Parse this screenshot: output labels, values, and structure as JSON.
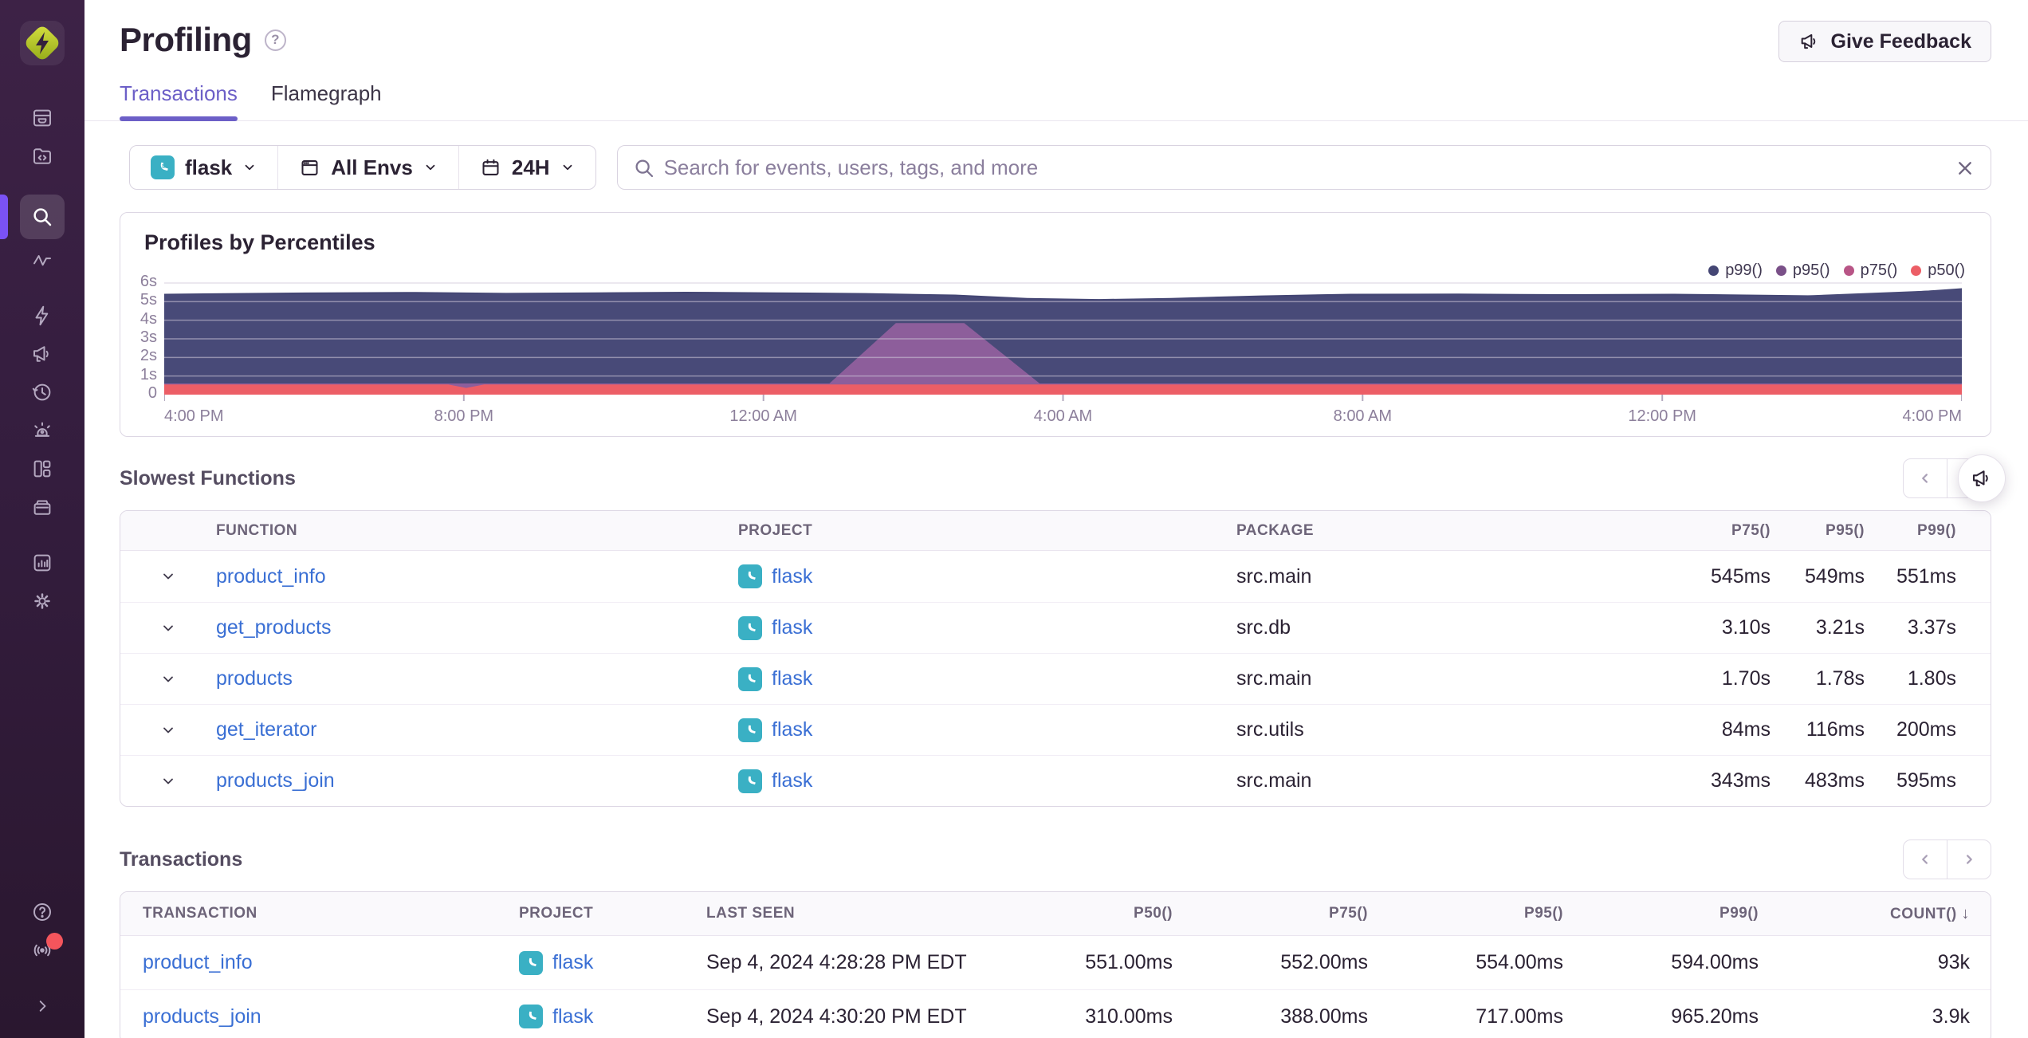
{
  "header": {
    "title": "Profiling",
    "help": "?",
    "feedback_label": "Give Feedback"
  },
  "tabs": {
    "items": [
      {
        "label": "Transactions",
        "active": true
      },
      {
        "label": "Flamegraph",
        "active": false
      }
    ]
  },
  "filters": {
    "project": "flask",
    "environment": "All Envs",
    "period": "24H"
  },
  "search": {
    "placeholder": "Search for events, users, tags, and more"
  },
  "sidebar": {
    "active_item": "search",
    "icons_top": [
      "org-logo",
      "issues-icon",
      "projects-icon",
      "search-icon",
      "metrics-icon",
      "quickstart-icon",
      "feedback-icon",
      "replays-icon",
      "alerts-icon",
      "dashboards-icon",
      "archive-icon",
      "stats-icon",
      "settings-icon"
    ],
    "icons_bottom": [
      "help-icon",
      "whats-new-icon",
      "collapse-icon"
    ],
    "notification_dot_color": "#f4555c",
    "accent_color": "#7a52f5"
  },
  "chart_panel": {
    "title": "Profiles by Percentiles"
  },
  "chart_data": {
    "type": "area",
    "title": "Profiles by Percentiles",
    "unit": "seconds",
    "ylim": [
      0,
      6
    ],
    "y_axis": [
      "0",
      "1s",
      "2s",
      "3s",
      "4s",
      "5s",
      "6s"
    ],
    "x_axis": [
      "4:00 PM",
      "8:00 PM",
      "12:00 AM",
      "4:00 AM",
      "8:00 AM",
      "12:00 PM",
      "4:00 PM"
    ],
    "legend_position": "top-right",
    "grid": true,
    "series": [
      {
        "name": "p99()",
        "legend_color": "#444674",
        "fill": "#444674",
        "points": [
          [
            0,
            5.42
          ],
          [
            0.04,
            5.46
          ],
          [
            0.09,
            5.5
          ],
          [
            0.14,
            5.52
          ],
          [
            0.19,
            5.47
          ],
          [
            0.24,
            5.5
          ],
          [
            0.29,
            5.53
          ],
          [
            0.34,
            5.5
          ],
          [
            0.39,
            5.46
          ],
          [
            0.44,
            5.38
          ],
          [
            0.48,
            5.2
          ],
          [
            0.52,
            5.14
          ],
          [
            0.56,
            5.2
          ],
          [
            0.61,
            5.33
          ],
          [
            0.66,
            5.42
          ],
          [
            0.72,
            5.43
          ],
          [
            0.78,
            5.4
          ],
          [
            0.84,
            5.42
          ],
          [
            0.89,
            5.37
          ],
          [
            0.93,
            5.32
          ],
          [
            0.96,
            5.45
          ],
          [
            1,
            5.72
          ]
        ]
      },
      {
        "name": "p95()",
        "legend_color": "#7a5088",
        "fill": "#484a78",
        "points": [
          [
            0,
            5.36
          ],
          [
            0.2,
            5.44
          ],
          [
            0.4,
            5.4
          ],
          [
            0.48,
            5.12
          ],
          [
            0.56,
            5.14
          ],
          [
            0.7,
            5.36
          ],
          [
            0.9,
            5.28
          ],
          [
            1,
            5.66
          ]
        ]
      },
      {
        "name": "p75()",
        "legend_color": "#b85586",
        "fill": "#8d5e9b",
        "points": [
          [
            0,
            0.6
          ],
          [
            0.37,
            0.6
          ],
          [
            0.407,
            3.85
          ],
          [
            0.445,
            3.85
          ],
          [
            0.487,
            0.6
          ],
          [
            1,
            0.6
          ]
        ]
      },
      {
        "name": "p50()",
        "legend_color": "#ec5e66",
        "fill": "#ec5e66",
        "points": [
          [
            0,
            0.55
          ],
          [
            0.158,
            0.55
          ],
          [
            0.168,
            0.36
          ],
          [
            0.178,
            0.55
          ],
          [
            1,
            0.55
          ]
        ]
      }
    ]
  },
  "slowest_functions": {
    "heading": "Slowest Functions",
    "columns": [
      "FUNCTION",
      "PROJECT",
      "PACKAGE",
      "P75()",
      "P95()",
      "P99()"
    ],
    "rows": [
      {
        "function": "product_info",
        "project": "flask",
        "package": "src.main",
        "p75": "545ms",
        "p95": "549ms",
        "p99": "551ms"
      },
      {
        "function": "get_products",
        "project": "flask",
        "package": "src.db",
        "p75": "3.10s",
        "p95": "3.21s",
        "p99": "3.37s"
      },
      {
        "function": "products",
        "project": "flask",
        "package": "src.main",
        "p75": "1.70s",
        "p95": "1.78s",
        "p99": "1.80s"
      },
      {
        "function": "get_iterator",
        "project": "flask",
        "package": "src.utils",
        "p75": "84ms",
        "p95": "116ms",
        "p99": "200ms"
      },
      {
        "function": "products_join",
        "project": "flask",
        "package": "src.main",
        "p75": "343ms",
        "p95": "483ms",
        "p99": "595ms"
      }
    ]
  },
  "transactions": {
    "heading": "Transactions",
    "columns": [
      "TRANSACTION",
      "PROJECT",
      "LAST SEEN",
      "P50()",
      "P75()",
      "P95()",
      "P99()",
      "COUNT()"
    ],
    "sort_column": "COUNT()",
    "sort_arrow": "↓",
    "rows": [
      {
        "transaction": "product_info",
        "project": "flask",
        "last_seen": "Sep 4, 2024 4:28:28 PM EDT",
        "p50": "551.00ms",
        "p75": "552.00ms",
        "p95": "554.00ms",
        "p99": "594.00ms",
        "count": "93k"
      },
      {
        "transaction": "products_join",
        "project": "flask",
        "last_seen": "Sep 4, 2024 4:30:20 PM EDT",
        "p50": "310.00ms",
        "p75": "388.00ms",
        "p95": "717.00ms",
        "p99": "965.20ms",
        "count": "3.9k"
      }
    ]
  }
}
